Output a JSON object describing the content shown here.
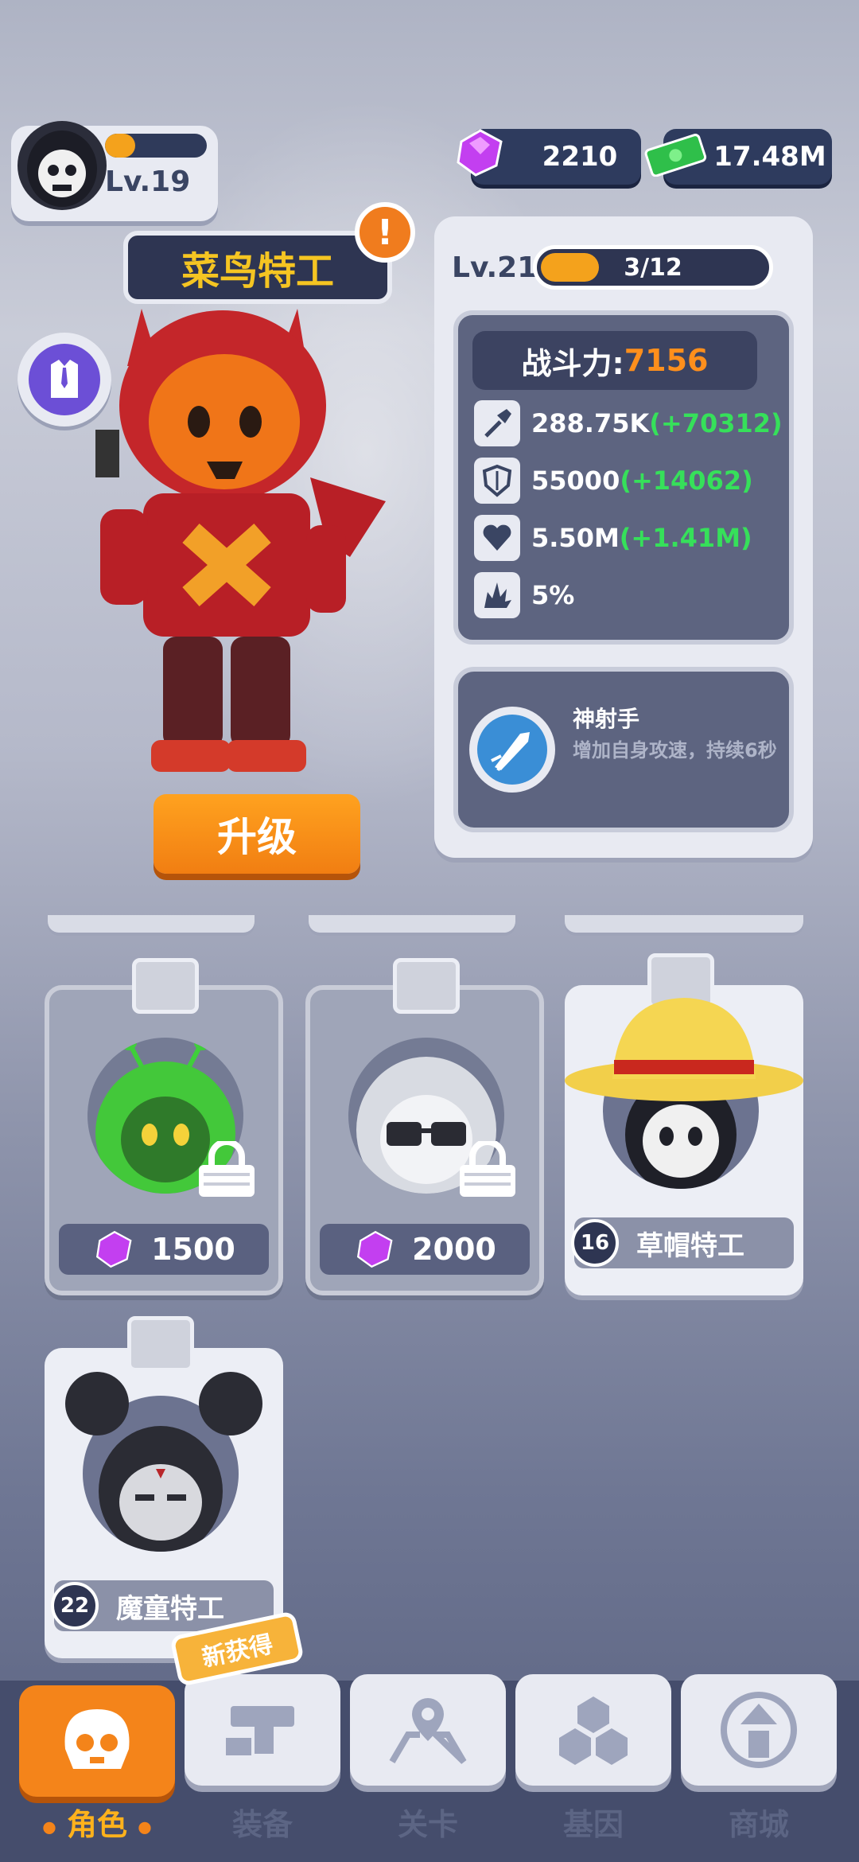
{
  "player": {
    "level": "Lv.19",
    "xp_progress": 0.3
  },
  "currency": {
    "gems": "2210",
    "cash": "17.48M"
  },
  "character": {
    "name": "菜鸟特工",
    "alert": "!",
    "upgrade_label": "升级"
  },
  "stats": {
    "level": "Lv.21",
    "progress_text": "3/12",
    "progress_fraction": 0.25,
    "power_label": "战斗力:",
    "power_value": "7156",
    "rows": [
      {
        "icon": "shovel-icon",
        "value": "288.75K",
        "bonus": "(+70312)"
      },
      {
        "icon": "shield-icon",
        "value": "55000",
        "bonus": "(+14062)"
      },
      {
        "icon": "heart-icon",
        "value": "5.50M",
        "bonus": "(+1.41M)"
      },
      {
        "icon": "crit-icon",
        "value": "5%",
        "bonus": ""
      }
    ]
  },
  "skill": {
    "icon": "bullet-icon",
    "name": "神射手",
    "desc": "增加自身攻速，持续6秒"
  },
  "cards": [
    {
      "type": "locked",
      "price": "1500",
      "portrait": "alien-agent"
    },
    {
      "type": "locked",
      "price": "2000",
      "portrait": "sunglasses-agent"
    },
    {
      "type": "owned",
      "level": "16",
      "name": "草帽特工",
      "portrait": "strawhat-agent"
    },
    {
      "type": "owned",
      "level": "22",
      "name": "魔童特工",
      "portrait": "demon-child-agent"
    }
  ],
  "nav": {
    "new_badge": "新获得",
    "tabs": [
      {
        "label": "角色",
        "icon": "skull-icon",
        "active": true
      },
      {
        "label": "装备",
        "icon": "equipment-icon",
        "active": false
      },
      {
        "label": "关卡",
        "icon": "map-icon",
        "active": false
      },
      {
        "label": "基因",
        "icon": "hexagon-icon",
        "active": false
      },
      {
        "label": "商城",
        "icon": "shop-icon",
        "active": false
      }
    ]
  },
  "colors": {
    "accent_orange": "#f4841a",
    "gold": "#f5c522",
    "bonus_green": "#36e05a",
    "panel_dark": "#2e3552"
  }
}
